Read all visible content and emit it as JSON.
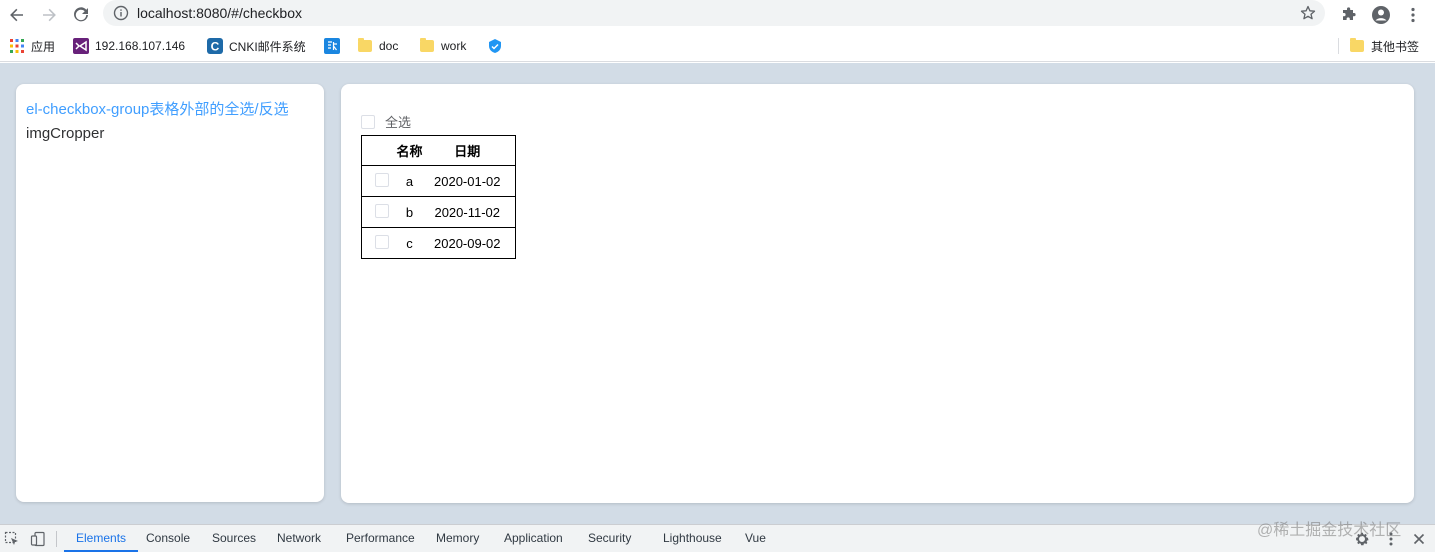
{
  "browser": {
    "url": "localhost:8080/#/checkbox",
    "icons": [
      "back-arrow-icon",
      "forward-arrow-icon",
      "reload-icon",
      "info-icon",
      "star-icon",
      "extensions-icon",
      "profile-icon",
      "menu-dots-icon"
    ]
  },
  "bookmarks": {
    "items": [
      {
        "label": "应用",
        "icon": "apps-grid-icon"
      },
      {
        "label": "192.168.107.146",
        "icon": "visual-studio-icon"
      },
      {
        "label": "CNKI邮件系统",
        "icon": "cnki-icon"
      },
      {
        "label": "",
        "icon": "translate-icon"
      },
      {
        "label": "doc",
        "icon": "folder-icon"
      },
      {
        "label": "work",
        "icon": "folder-icon"
      },
      {
        "label": "",
        "icon": "shield-icon"
      }
    ],
    "other": {
      "label": "其他书签",
      "icon": "folder-icon"
    }
  },
  "sidebar": {
    "links": [
      {
        "label": "el-checkbox-group表格外部的全选/反选",
        "active": true
      },
      {
        "label": "imgCropper",
        "active": false
      }
    ]
  },
  "main": {
    "select_all_label": "全选",
    "table": {
      "headers": [
        "",
        "名称",
        "日期"
      ],
      "rows": [
        {
          "name": "a",
          "date": "2020-01-02"
        },
        {
          "name": "b",
          "date": "2020-11-02"
        },
        {
          "name": "c",
          "date": "2020-09-02"
        }
      ]
    }
  },
  "devtools": {
    "tabs": [
      "Elements",
      "Console",
      "Sources",
      "Network",
      "Performance",
      "Memory",
      "Application",
      "Security",
      "Lighthouse",
      "Vue"
    ],
    "active_tab": "Elements"
  },
  "watermark": "@稀土掘金技术社区",
  "colors": {
    "accent": "#409eff",
    "page_bg": "#d2dce6",
    "devtools_active": "#1a73e8"
  }
}
